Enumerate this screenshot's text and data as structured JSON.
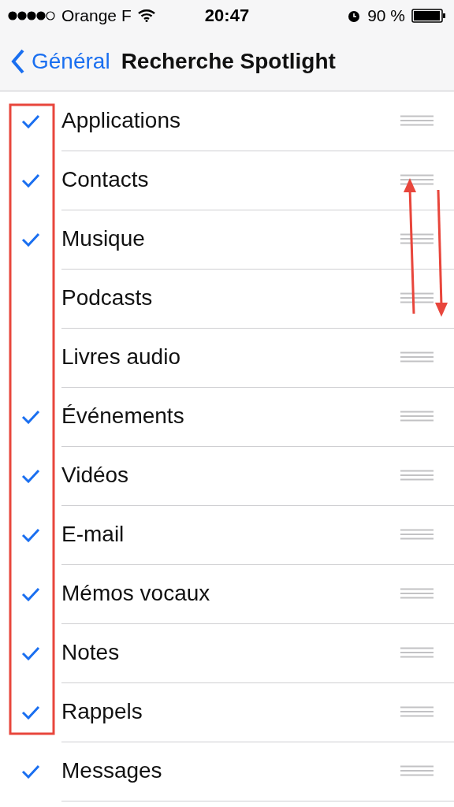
{
  "status_bar": {
    "carrier": "Orange F",
    "time": "20:47",
    "battery": "90 %"
  },
  "nav": {
    "back": "Général",
    "title": "Recherche Spotlight"
  },
  "items": [
    {
      "label": "Applications",
      "checked": true
    },
    {
      "label": "Contacts",
      "checked": true
    },
    {
      "label": "Musique",
      "checked": true
    },
    {
      "label": "Podcasts",
      "checked": false
    },
    {
      "label": "Livres audio",
      "checked": false
    },
    {
      "label": "Événements",
      "checked": true
    },
    {
      "label": "Vidéos",
      "checked": true
    },
    {
      "label": "E-mail",
      "checked": true
    },
    {
      "label": "Mémos vocaux",
      "checked": true
    },
    {
      "label": "Notes",
      "checked": true
    },
    {
      "label": "Rappels",
      "checked": true
    },
    {
      "label": "Messages",
      "checked": true
    }
  ]
}
